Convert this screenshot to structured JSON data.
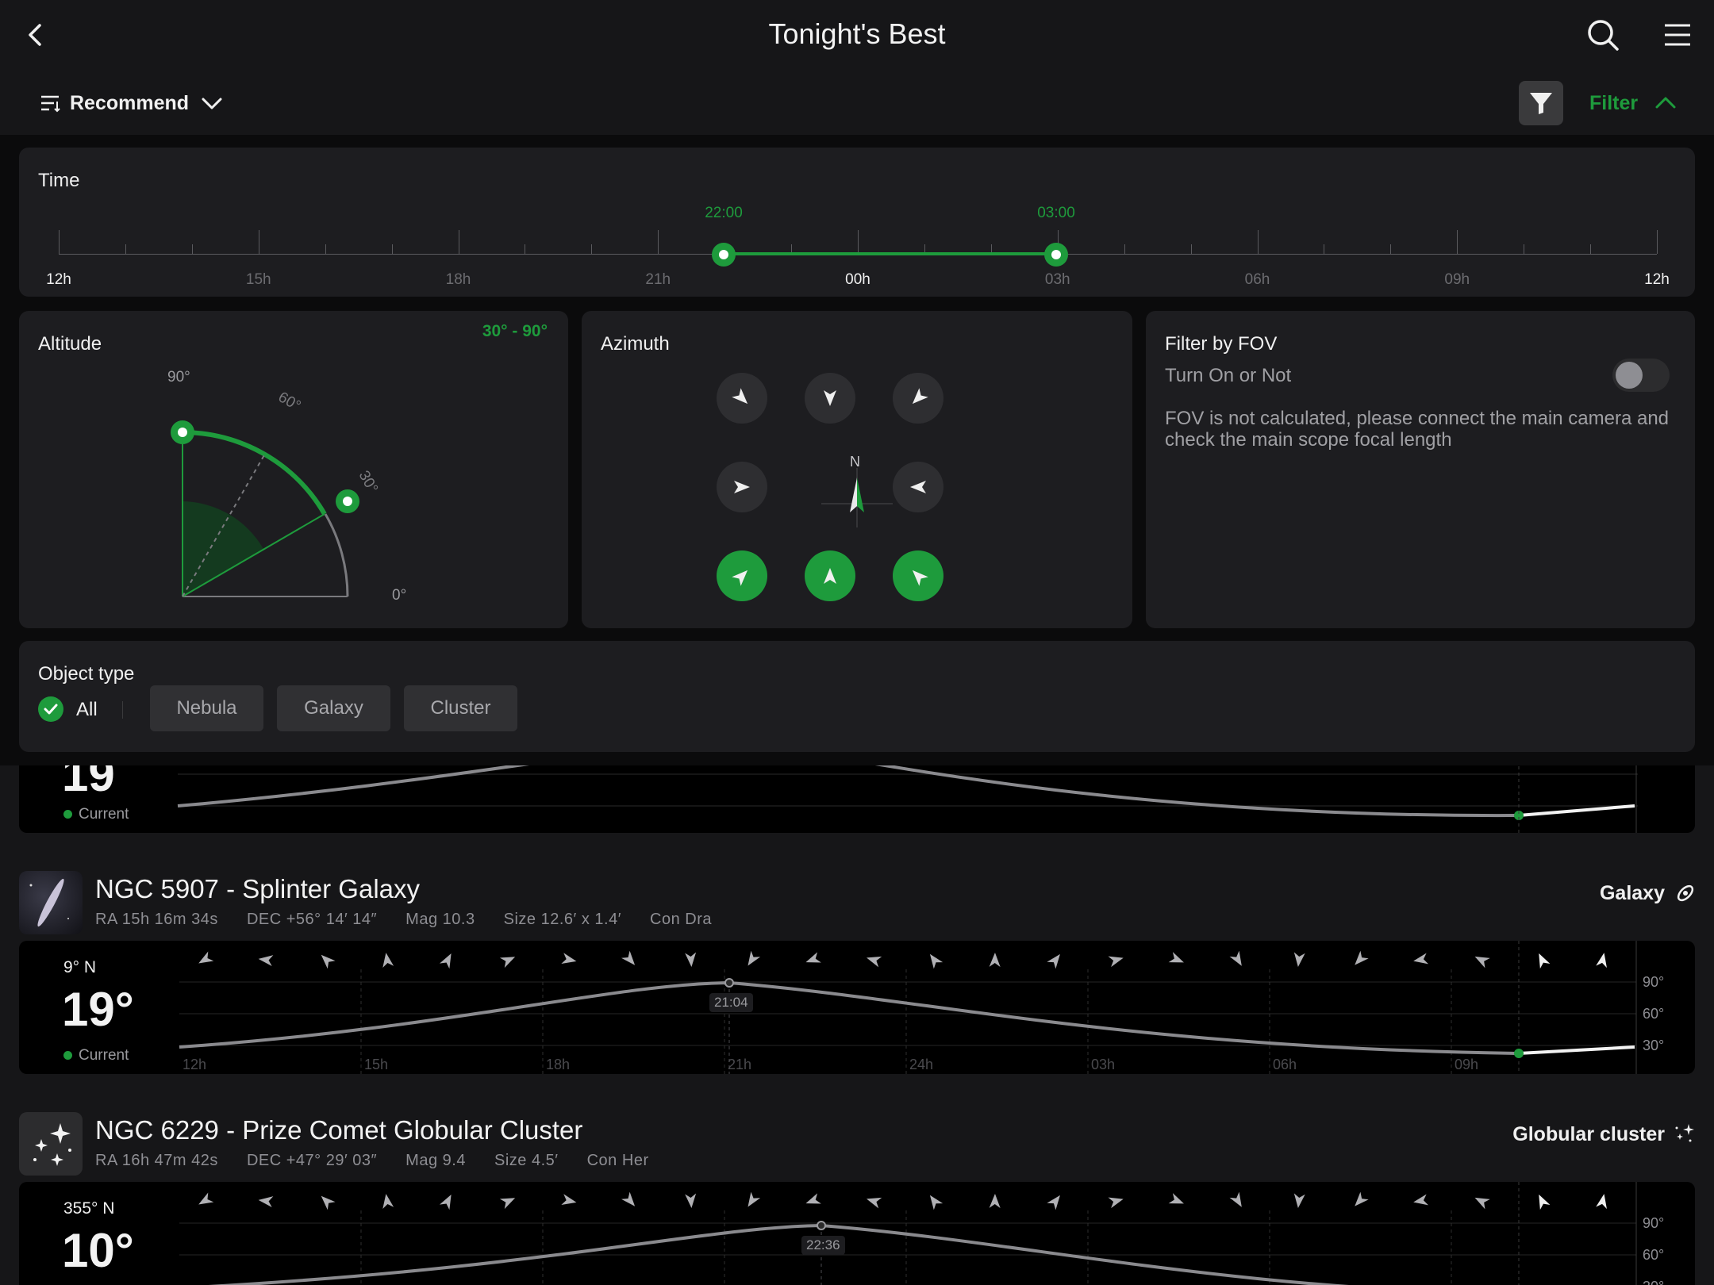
{
  "header": {
    "title": "Tonight's Best"
  },
  "sort": {
    "label": "Recommend"
  },
  "filter": {
    "label": "Filter"
  },
  "time": {
    "title": "Time",
    "hours": [
      "12h",
      "15h",
      "18h",
      "21h",
      "00h",
      "03h",
      "06h",
      "09h",
      "12h"
    ],
    "start": "22:00",
    "end": "03:00"
  },
  "altitude": {
    "title": "Altitude",
    "range": "30° - 90°",
    "labels": {
      "deg90": "90°",
      "deg60": "60°",
      "deg30": "30°",
      "deg0": "0°"
    }
  },
  "azimuth": {
    "title": "Azimuth",
    "north": "N",
    "directions": [
      {
        "name": "NW",
        "on": false
      },
      {
        "name": "N",
        "on": false
      },
      {
        "name": "NE",
        "on": false
      },
      {
        "name": "W",
        "on": false
      },
      {
        "name": "E",
        "on": false
      },
      {
        "name": "SW",
        "on": true
      },
      {
        "name": "S",
        "on": true
      },
      {
        "name": "SE",
        "on": true
      }
    ]
  },
  "fov": {
    "title": "Filter by FOV",
    "toggle_label": "Turn On or Not",
    "toggle_on": false,
    "note": "FOV is not calculated, please connect the main camera and check the main scope focal length"
  },
  "object_type": {
    "title": "Object type",
    "all_label": "All",
    "chips": [
      "Nebula",
      "Galaxy",
      "Cluster"
    ]
  },
  "colors": {
    "accent": "#1e9b3c",
    "background": "#161618",
    "card": "#1d1d20"
  },
  "list": {
    "hour_labels": [
      "12h",
      "15h",
      "18h",
      "21h",
      "24h",
      "03h",
      "06h",
      "09h"
    ],
    "alt_labels": [
      "90°",
      "60°",
      "30°"
    ],
    "current_label": "Current",
    "partial_item": {
      "altitude": "19"
    },
    "items": [
      {
        "name": "NGC 5907 - Splinter Galaxy",
        "type": "Galaxy",
        "type_icon": "galaxy-icon",
        "ra_label": "RA",
        "ra": "15h 16m 34s",
        "dec_label": "DEC",
        "dec": "+56° 14′ 14″",
        "mag_label": "Mag",
        "mag": "10.3",
        "size_label": "Size",
        "size": "12.6′ x 1.4′",
        "con_label": "Con",
        "con": "Dra",
        "direction": "9° N",
        "altitude": "19°",
        "peak_time": "21:04"
      },
      {
        "name": "NGC 6229 - Prize Comet Globular Cluster",
        "type": "Globular cluster",
        "type_icon": "sparkle-icon",
        "ra_label": "RA",
        "ra": "16h 47m 42s",
        "dec_label": "DEC",
        "dec": "+47° 29′ 03″",
        "mag_label": "Mag",
        "mag": "9.4",
        "size_label": "Size",
        "size": "4.5′",
        "con_label": "Con",
        "con": "Her",
        "direction": "355° N",
        "altitude": "10°",
        "peak_time": "22:36"
      }
    ]
  }
}
